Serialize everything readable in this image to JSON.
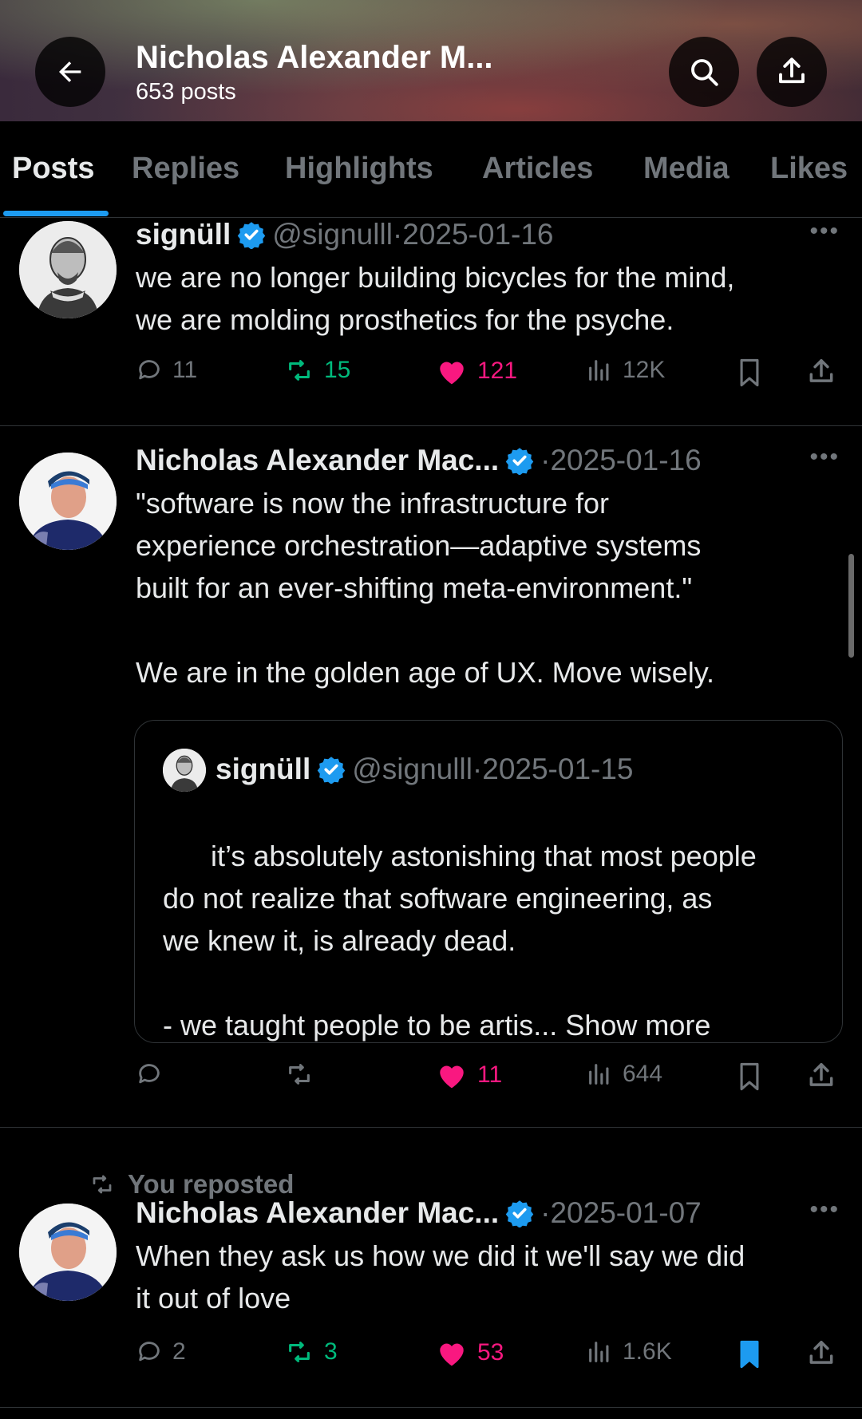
{
  "header": {
    "title": "Nicholas Alexander M...",
    "post_count": "653 posts",
    "back_icon": "arrow-left-icon",
    "search_icon": "search-icon",
    "share_icon": "share-icon"
  },
  "tabs": [
    {
      "label": "Posts",
      "active": true
    },
    {
      "label": "Replies"
    },
    {
      "label": "Highlights"
    },
    {
      "label": "Articles"
    },
    {
      "label": "Media"
    },
    {
      "label": "Likes"
    }
  ],
  "colors": {
    "accent": "#1d9bf0",
    "like": "#f91880",
    "repost": "#00ba7c",
    "muted": "#71767b"
  },
  "posts": [
    {
      "name": "signüll",
      "handle": "@signulll",
      "date": "·2025-01-16",
      "text": "we are no longer building bicycles for the mind,\nwe are molding prosthetics for the psyche.",
      "replies": "11",
      "reposts": "15",
      "likes": "121",
      "views": "12K"
    },
    {
      "name": "Nicholas Alexander Mac...",
      "date": "·2025-01-16",
      "text": "\"software is now the infrastructure for\nexperience orchestration—adaptive systems\nbuilt for an ever-shifting meta-environment.\"\n\nWe are in the golden age of UX. Move wisely.",
      "quote": {
        "name": "signüll",
        "handle": "@signulll",
        "date": "·2025-01-15",
        "text": "it’s absolutely astonishing that most people\ndo not realize that software engineering, as\nwe knew it, is already dead.\n\n- we taught people to be artis... ",
        "show_more": "Show more"
      },
      "likes": "11",
      "views": "644"
    },
    {
      "repost_label": "You reposted",
      "name": "Nicholas Alexander Mac...",
      "date": "·2025-01-07",
      "text": "When they ask us how we did it we'll say we did\nit out of love",
      "replies": "2",
      "reposts": "3",
      "likes": "53",
      "views": "1.6K",
      "bookmarked": true
    }
  ]
}
